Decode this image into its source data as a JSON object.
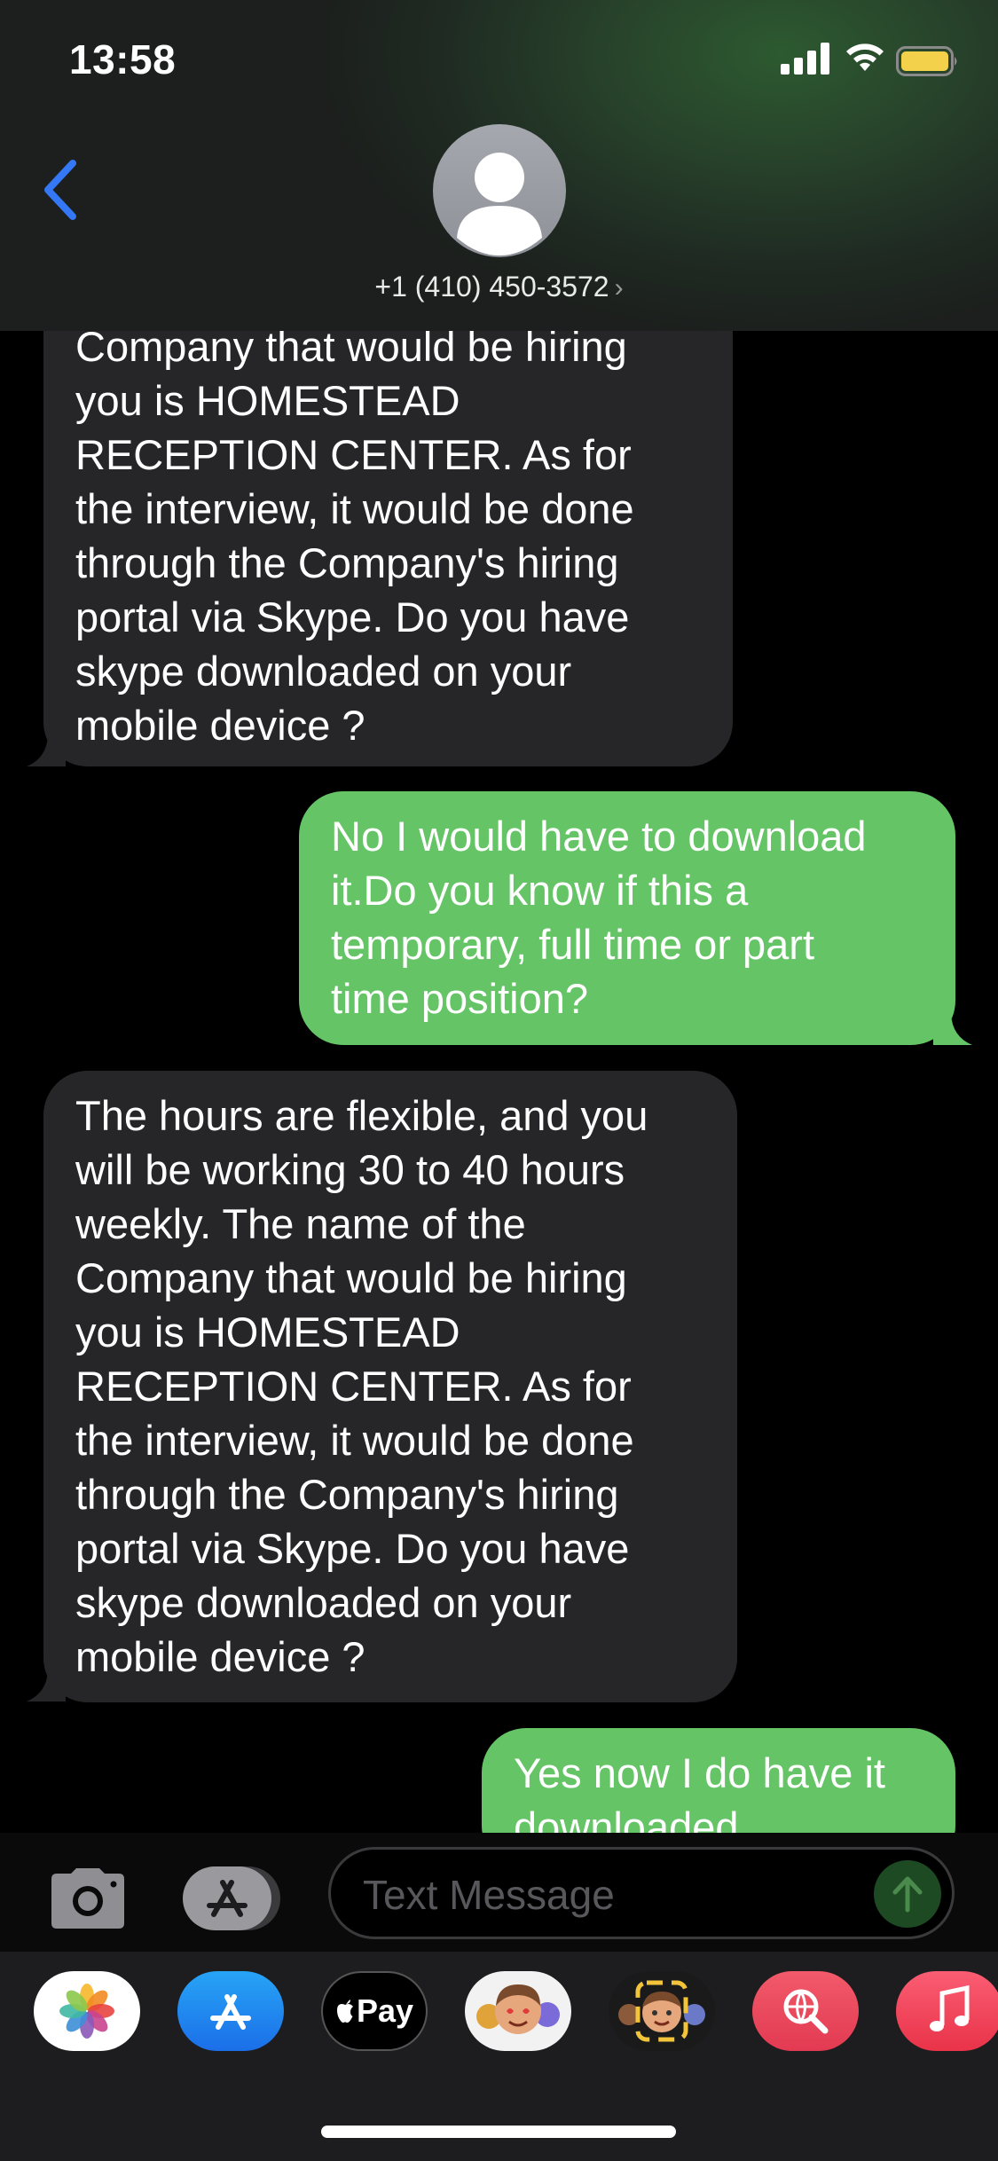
{
  "status_bar": {
    "time": "13:58"
  },
  "header": {
    "contact": "+1 (410) 450-3572"
  },
  "messages": [
    {
      "direction": "incoming",
      "text": "Company that would be hiring\nyou is HOMESTEAD\nRECEPTION CENTER. As for\nthe interview, it would be done\nthrough the Company's hiring\nportal via Skype. Do you have\nskype downloaded on your\nmobile device ?"
    },
    {
      "direction": "outgoing",
      "text": "No I would have to download\nit.Do you know if this a\ntemporary, full time or part\ntime  position?"
    },
    {
      "direction": "incoming",
      "text": "The hours are flexible, and you\nwill be working 30 to 40 hours\nweekly. The name of the\nCompany that would be hiring\nyou is HOMESTEAD\nRECEPTION CENTER. As for\nthe interview, it would be done\nthrough the Company's hiring\nportal via Skype. Do you have\nskype downloaded on your\nmobile device ?"
    },
    {
      "direction": "outgoing",
      "text": "Yes now I do have it\ndownloaded"
    }
  ],
  "composer": {
    "placeholder": "Text Message"
  },
  "app_drawer": {
    "apps": [
      {
        "name": "photos-icon"
      },
      {
        "name": "app-store-icon"
      },
      {
        "name": "apple-pay-icon",
        "label": "Pay"
      },
      {
        "name": "memoji-stickers-icon"
      },
      {
        "name": "memoji-icon"
      },
      {
        "name": "web-images-icon"
      },
      {
        "name": "music-icon"
      }
    ]
  },
  "colors": {
    "incoming_bubble": "#262628",
    "outgoing_bubble": "#65c466",
    "accent_blue": "#3478f6"
  }
}
